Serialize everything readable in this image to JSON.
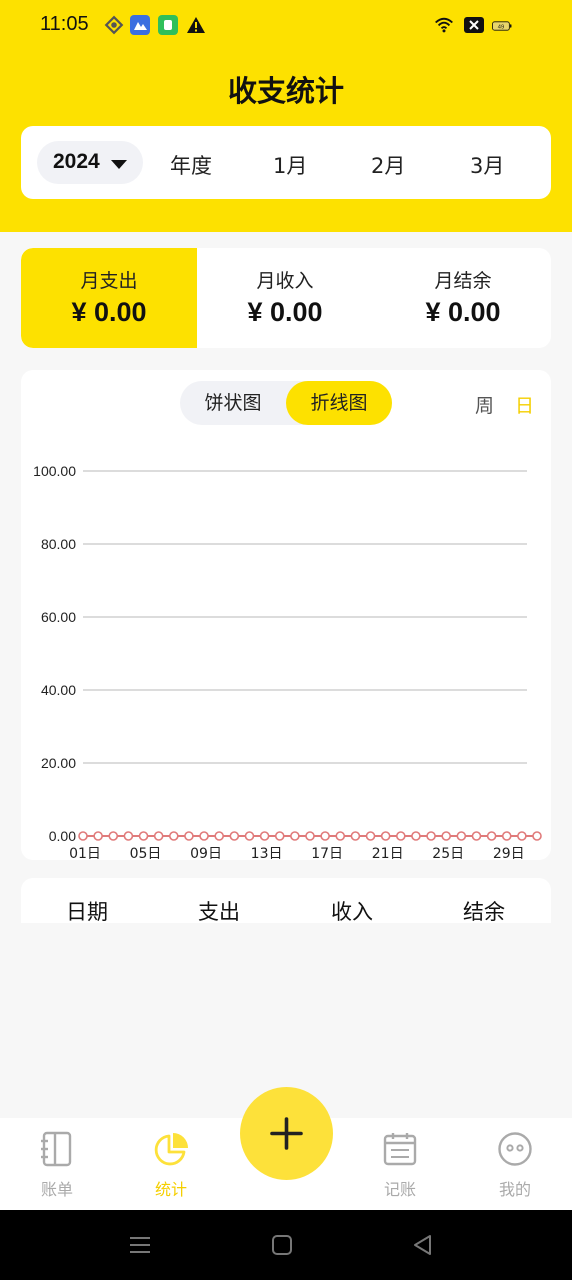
{
  "status_bar": {
    "time": "11:05",
    "battery": "49",
    "icons": [
      "location-icon",
      "app-notification-icon",
      "shield-app-icon",
      "warning-icon",
      "wifi-icon",
      "no-sim-icon",
      "battery-icon"
    ]
  },
  "header": {
    "title": "收支统计"
  },
  "period": {
    "year": "2024",
    "tabs": [
      "年度",
      "1月",
      "2月",
      "3月"
    ]
  },
  "summary": {
    "expense_label": "月支出",
    "expense_value": "¥ 0.00",
    "income_label": "月收入",
    "income_value": "¥ 0.00",
    "balance_label": "月结余",
    "balance_value": "¥ 0.00"
  },
  "chart_toggle": {
    "pie_label": "饼状图",
    "line_label": "折线图",
    "week_label": "周",
    "day_label": "日"
  },
  "chart_data": {
    "type": "line",
    "ylim": [
      0,
      100
    ],
    "yticks": [
      "100.00",
      "80.00",
      "60.00",
      "40.00",
      "20.00",
      "0.00"
    ],
    "ytick_values": [
      100,
      80,
      60,
      40,
      20,
      0
    ],
    "xtick_labels": [
      "01日",
      "05日",
      "09日",
      "13日",
      "17日",
      "21日",
      "25日",
      "29日"
    ],
    "x": [
      1,
      2,
      3,
      4,
      5,
      6,
      7,
      8,
      9,
      10,
      11,
      12,
      13,
      14,
      15,
      16,
      17,
      18,
      19,
      20,
      21,
      22,
      23,
      24,
      25,
      26,
      27,
      28,
      29,
      30,
      31
    ],
    "series": [
      {
        "values": [
          0,
          0,
          0,
          0,
          0,
          0,
          0,
          0,
          0,
          0,
          0,
          0,
          0,
          0,
          0,
          0,
          0,
          0,
          0,
          0,
          0,
          0,
          0,
          0,
          0,
          0,
          0,
          0,
          0,
          0,
          0
        ]
      }
    ],
    "line_color": "#e07a7a",
    "grid": true
  },
  "table": {
    "headers": [
      "日期",
      "支出",
      "收入",
      "结余"
    ]
  },
  "tabbar": {
    "items": [
      {
        "label": "账单",
        "icon": "bill-book-icon"
      },
      {
        "label": "统计",
        "icon": "pie-chart-icon"
      },
      {
        "label": "记账",
        "icon": "calendar-icon"
      },
      {
        "label": "我的",
        "icon": "profile-face-icon"
      }
    ],
    "add_icon": "plus-icon"
  },
  "colors": {
    "accent": "#fde100",
    "active_text": "#f5cf00"
  }
}
